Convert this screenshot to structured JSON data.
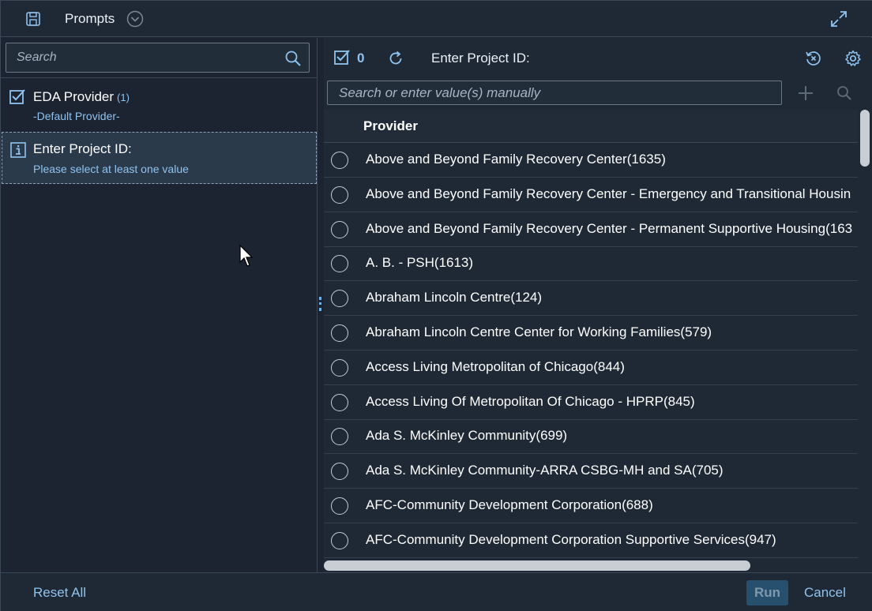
{
  "header": {
    "title": "Prompts",
    "icons": [
      "save-icon",
      "chevron-down-icon",
      "expand-icon"
    ]
  },
  "left": {
    "search_placeholder": "Search",
    "items": [
      {
        "title": "EDA Provider",
        "count": "(1)",
        "subtitle": "-Default Provider-",
        "icon": "checkbox-checked-icon"
      },
      {
        "title": "Enter Project ID:",
        "subtitle": "Please select at least one value",
        "icon": "info-icon"
      }
    ]
  },
  "right": {
    "selected_count": "0",
    "prompt_label": "Enter Project ID:",
    "value_search_placeholder": "Search or enter value(s) manually",
    "column_header": "Provider",
    "rows": [
      "Above and Beyond Family Recovery Center(1635)",
      "Above and Beyond Family Recovery Center - Emergency and Transitional Housin",
      "Above and Beyond Family Recovery Center - Permanent Supportive Housing(163",
      "A. B. - PSH(1613)",
      "Abraham Lincoln Centre(124)",
      "Abraham Lincoln Centre Center for Working Families(579)",
      "Access Living Metropolitan of Chicago(844)",
      "Access Living Of Metropolitan Of Chicago - HPRP(845)",
      "Ada S. McKinley Community(699)",
      "Ada S. McKinley Community-ARRA CSBG-MH and SA(705)",
      "AFC-Community Development Corporation(688)",
      "AFC-Community Development Corporation Supportive Services(947)"
    ]
  },
  "footer": {
    "reset_label": "Reset All",
    "run_label": "Run",
    "cancel_label": "Cancel"
  },
  "colors": {
    "background": "#1d2733",
    "accent": "#8fc3ef",
    "selected_row": "#2a3a4b",
    "run_button": "#27506f"
  }
}
